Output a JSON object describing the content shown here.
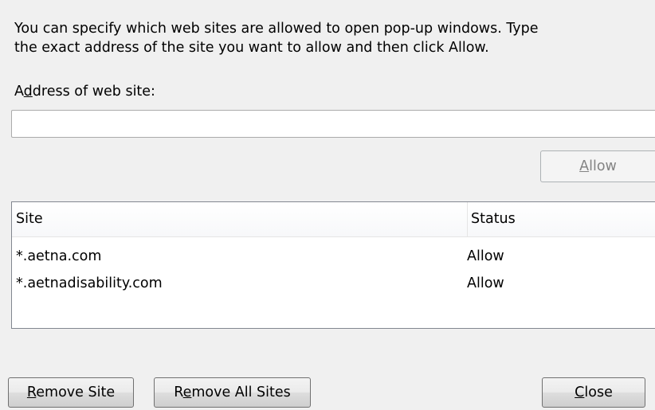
{
  "description": {
    "line1": "You can specify which web sites are allowed to open pop-up windows. Type",
    "line2": "the exact address of the site you want to allow and then click Allow."
  },
  "address": {
    "label_pre": "A",
    "label_key": "d",
    "label_post": "dress of web site:",
    "value": "",
    "placeholder": ""
  },
  "allow_button": {
    "key": "A",
    "rest": "llow"
  },
  "list": {
    "columns": [
      "Site",
      "Status"
    ],
    "rows": [
      {
        "site": "*.aetna.com",
        "status": "Allow"
      },
      {
        "site": "*.aetnadisability.com",
        "status": "Allow"
      }
    ]
  },
  "buttons": {
    "remove_site": {
      "key": "R",
      "rest": "emove Site"
    },
    "remove_all": {
      "pre": "R",
      "key": "e",
      "rest": "move All Sites"
    },
    "close": {
      "key": "C",
      "rest": "lose"
    }
  }
}
